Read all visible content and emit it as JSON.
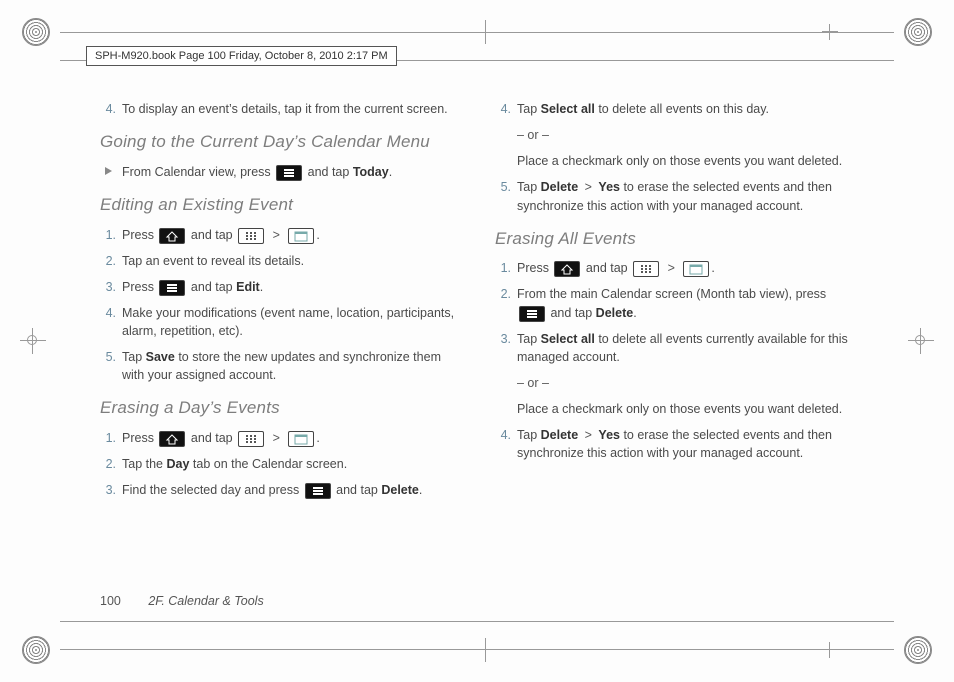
{
  "header": "SPH-M920.book  Page 100  Friday, October 8, 2010  2:17 PM",
  "footer": {
    "page": "100",
    "section": "2F. Calendar & Tools"
  },
  "headings": {
    "goto_today": "Going to the Current Day’s Calendar Menu",
    "edit_event": "Editing an Existing Event",
    "erase_day": "Erasing a Day’s Events",
    "erase_all": "Erasing All Events"
  },
  "lines": {
    "l4_details": "To display an event’s details, tap it from the current screen.",
    "goto_body_a": "From Calendar view, press ",
    "goto_body_b": " and tap ",
    "label_today": "Today",
    "period": ".",
    "edit_1a": "Press ",
    "edit_1b": " and tap ",
    "edit_2": "Tap an event to reveal its details.",
    "edit_3a": "Press ",
    "edit_3b": " and tap ",
    "label_edit": "Edit",
    "edit_4": "Make your modifications (event name, location, participants, alarm, repetition, etc).",
    "edit_5a": "Tap ",
    "label_save": "Save",
    "edit_5b": " to store the new updates and synchronize them with your assigned account.",
    "eday_1a": "Press ",
    "eday_1b": " and tap ",
    "eday_2a": "Tap the ",
    "label_day": "Day",
    "eday_2b": " tab on the Calendar screen.",
    "eday_3a": "Find the selected day and press ",
    "eday_3b": " and tap ",
    "label_delete": "Delete",
    "r4a": "Tap ",
    "label_select_all": "Select all",
    "r4b": " to delete all events on this day.",
    "or": "– or –",
    "r4_alt": "Place a checkmark only on those events you want deleted.",
    "r5a": "Tap ",
    "label_yes": "Yes",
    "gt": " > ",
    "r5b": " to erase the selected events and then synchronize this action with your managed account.",
    "ea_1a": "Press ",
    "ea_1b": " and tap ",
    "ea_2a": "From the main Calendar screen (Month tab view), press ",
    "ea_2b": " and tap ",
    "ea_3a": "Tap ",
    "ea_3b": " to delete all events currently available for this managed account.",
    "ea_3_alt": "Place a checkmark only on those events you want deleted.",
    "ea_4a": "Tap ",
    "ea_4b": " to erase the selected events and then synchronize this action with your managed account."
  },
  "nums": {
    "n1": "1.",
    "n2": "2.",
    "n3": "3.",
    "n4": "4.",
    "n5": "5."
  }
}
